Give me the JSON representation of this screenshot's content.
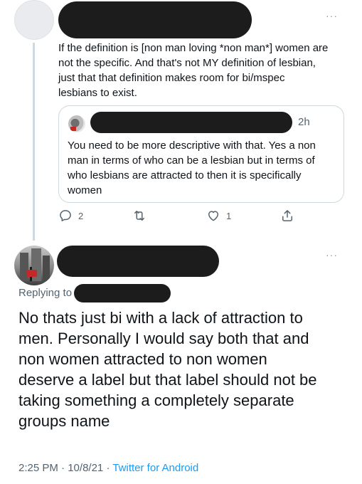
{
  "quoted_context_tweet": {
    "text": "If the definition is [non man loving *non man*] women are\nnot the specific. And that's not MY definition of lesbian,\njust that that definition makes room for bi/mspec\nlesbians to exist.",
    "more_label": "···"
  },
  "quote_card": {
    "time": "2h",
    "text": "You need to be more descriptive with that. Yes a non\nman in terms of who can be a lesbian but in terms of\nwho lesbians are attracted to then it is specifically\nwomen"
  },
  "actions": {
    "reply_count": "2",
    "retweet_count": "",
    "like_count": "1"
  },
  "reply_tweet": {
    "more_label": "···",
    "replying_to_label": "Replying to",
    "text": "No thats just bi with a lack of attraction to\nmen. Personally I would say both that and\nnon women attracted to non women\ndeserve a label but that label should not be\ntaking something a completely separate\ngroups name",
    "time": "2:25 PM",
    "date": "10/8/21",
    "separator": "·",
    "source": "Twitter for Android"
  },
  "colors": {
    "text": "#0f1419",
    "secondary": "#536471",
    "link": "#1d9bf0",
    "border": "#cfd9de",
    "redaction": "#1c1c1c"
  }
}
